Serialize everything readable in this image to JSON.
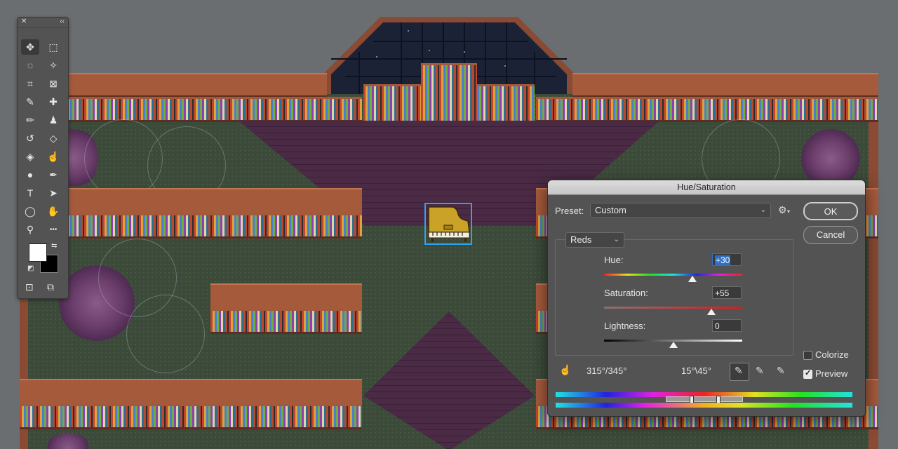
{
  "toolbar": {
    "close_glyph": "✕",
    "collapse_glyph": "‹‹",
    "tools": [
      {
        "name": "move-tool",
        "glyph": "✥"
      },
      {
        "name": "marquee-tool",
        "glyph": "⬚"
      },
      {
        "name": "lasso-tool",
        "glyph": "◌"
      },
      {
        "name": "magic-wand-tool",
        "glyph": "✧"
      },
      {
        "name": "crop-tool",
        "glyph": "⌗"
      },
      {
        "name": "frame-tool",
        "glyph": "⊠"
      },
      {
        "name": "eyedropper-tool",
        "glyph": "✎"
      },
      {
        "name": "healing-tool",
        "glyph": "✚"
      },
      {
        "name": "brush-tool",
        "glyph": "✏"
      },
      {
        "name": "stamp-tool",
        "glyph": "♟"
      },
      {
        "name": "history-brush-tool",
        "glyph": "↺"
      },
      {
        "name": "eraser-tool",
        "glyph": "◇"
      },
      {
        "name": "paint-bucket-tool",
        "glyph": "◈"
      },
      {
        "name": "smudge-tool",
        "glyph": "☝"
      },
      {
        "name": "dodge-tool",
        "glyph": "●"
      },
      {
        "name": "pen-tool",
        "glyph": "✒"
      },
      {
        "name": "type-tool",
        "glyph": "T"
      },
      {
        "name": "path-select-tool",
        "glyph": "➤"
      },
      {
        "name": "shape-tool",
        "glyph": "◯"
      },
      {
        "name": "hand-tool",
        "glyph": "✋"
      },
      {
        "name": "zoom-tool",
        "glyph": "⚲"
      },
      {
        "name": "more-tools",
        "glyph": "•••"
      }
    ],
    "quick_mask_glyph": "⊡",
    "screen_mode_glyph": "⧉"
  },
  "dialog": {
    "title": "Hue/Saturation",
    "preset_label": "Preset:",
    "preset_value": "Custom",
    "ok_label": "OK",
    "cancel_label": "Cancel",
    "channel_value": "Reds",
    "hue_label": "Hue:",
    "hue_value": "+30",
    "hue_fraction": 0.64,
    "saturation_label": "Saturation:",
    "saturation_value": "+55",
    "saturation_fraction": 0.775,
    "lightness_label": "Lightness:",
    "lightness_value": "0",
    "lightness_fraction": 0.5,
    "colorize_label": "Colorize",
    "colorize_checked": false,
    "preview_label": "Preview",
    "preview_checked": true,
    "range_left": "315°/345°",
    "range_right": "15°\\45°",
    "gear_glyph": "⚙",
    "hand_glyph": "☝"
  }
}
